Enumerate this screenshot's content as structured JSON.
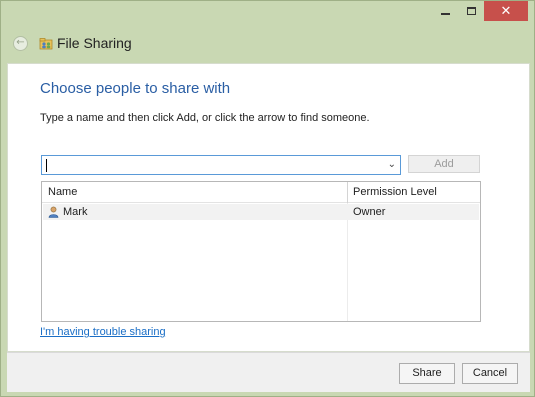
{
  "window": {
    "title": "File Sharing",
    "icons": {
      "back": "back-arrow-icon",
      "app": "file-sharing-icon",
      "minimize": "minimize-icon",
      "maximize": "maximize-icon",
      "close": "close-icon"
    }
  },
  "dialog": {
    "heading": "Choose people to share with",
    "instruction": "Type a name and then click Add, or click the arrow to find someone.",
    "name_input": {
      "value": "",
      "placeholder": ""
    },
    "add_label": "Add",
    "table": {
      "columns": [
        "Name",
        "Permission Level"
      ],
      "rows": [
        {
          "name": "Mark",
          "permission": "Owner",
          "icon": "user-icon"
        }
      ]
    },
    "trouble_link": "I'm having trouble sharing"
  },
  "footer": {
    "share_label": "Share",
    "cancel_label": "Cancel"
  },
  "colors": {
    "frame": "#c9d8b3",
    "heading": "#2a5ea4",
    "link": "#1a6ec6",
    "close": "#c7504b",
    "focus_border": "#5a9ad8"
  }
}
